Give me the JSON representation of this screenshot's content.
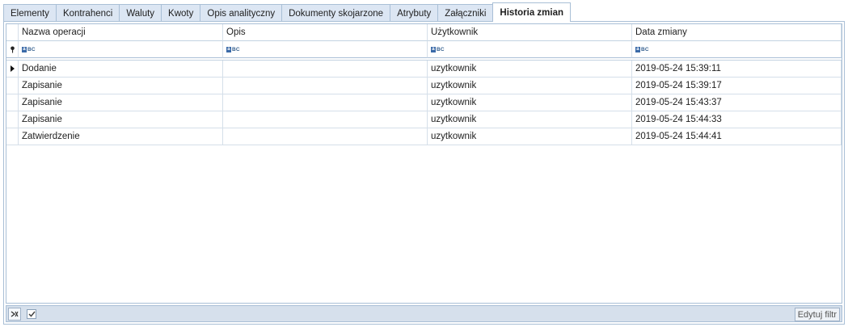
{
  "tabs": [
    {
      "label": "Elementy"
    },
    {
      "label": "Kontrahenci"
    },
    {
      "label": "Waluty"
    },
    {
      "label": "Kwoty"
    },
    {
      "label": "Opis analityczny"
    },
    {
      "label": "Dokumenty skojarzone"
    },
    {
      "label": "Atrybuty"
    },
    {
      "label": "Załączniki"
    },
    {
      "label": "Historia zmian"
    }
  ],
  "active_tab": "Historia zmian",
  "grid": {
    "columns": [
      "Nazwa operacji",
      "Opis",
      "Użytkownik",
      "Data zmiany"
    ],
    "filter_placeholder": "BC",
    "rows": [
      {
        "operation": "Dodanie",
        "description": "",
        "user": "uzytkownik",
        "date": "2019-05-24 15:39:11"
      },
      {
        "operation": "Zapisanie",
        "description": "",
        "user": "uzytkownik",
        "date": "2019-05-24 15:39:17"
      },
      {
        "operation": "Zapisanie",
        "description": "",
        "user": "uzytkownik",
        "date": "2019-05-24 15:43:37"
      },
      {
        "operation": "Zapisanie",
        "description": "",
        "user": "uzytkownik",
        "date": "2019-05-24 15:44:33"
      },
      {
        "operation": "Zatwierdzenie",
        "description": "",
        "user": "uzytkownik",
        "date": "2019-05-24 15:44:41"
      }
    ]
  },
  "bottom": {
    "edit_filter_label": "Edytuj filtr",
    "filter_enabled": true
  },
  "colors": {
    "tab_bg": "#dce6f3",
    "border": "#a9bfd6",
    "bottombar_bg": "#d6e0ec"
  },
  "icons": {
    "filter_row": "pin-icon",
    "clear_filter": "clear-filter-icon",
    "text_filter": "abc-icon",
    "current_row": "row-indicator-icon"
  }
}
